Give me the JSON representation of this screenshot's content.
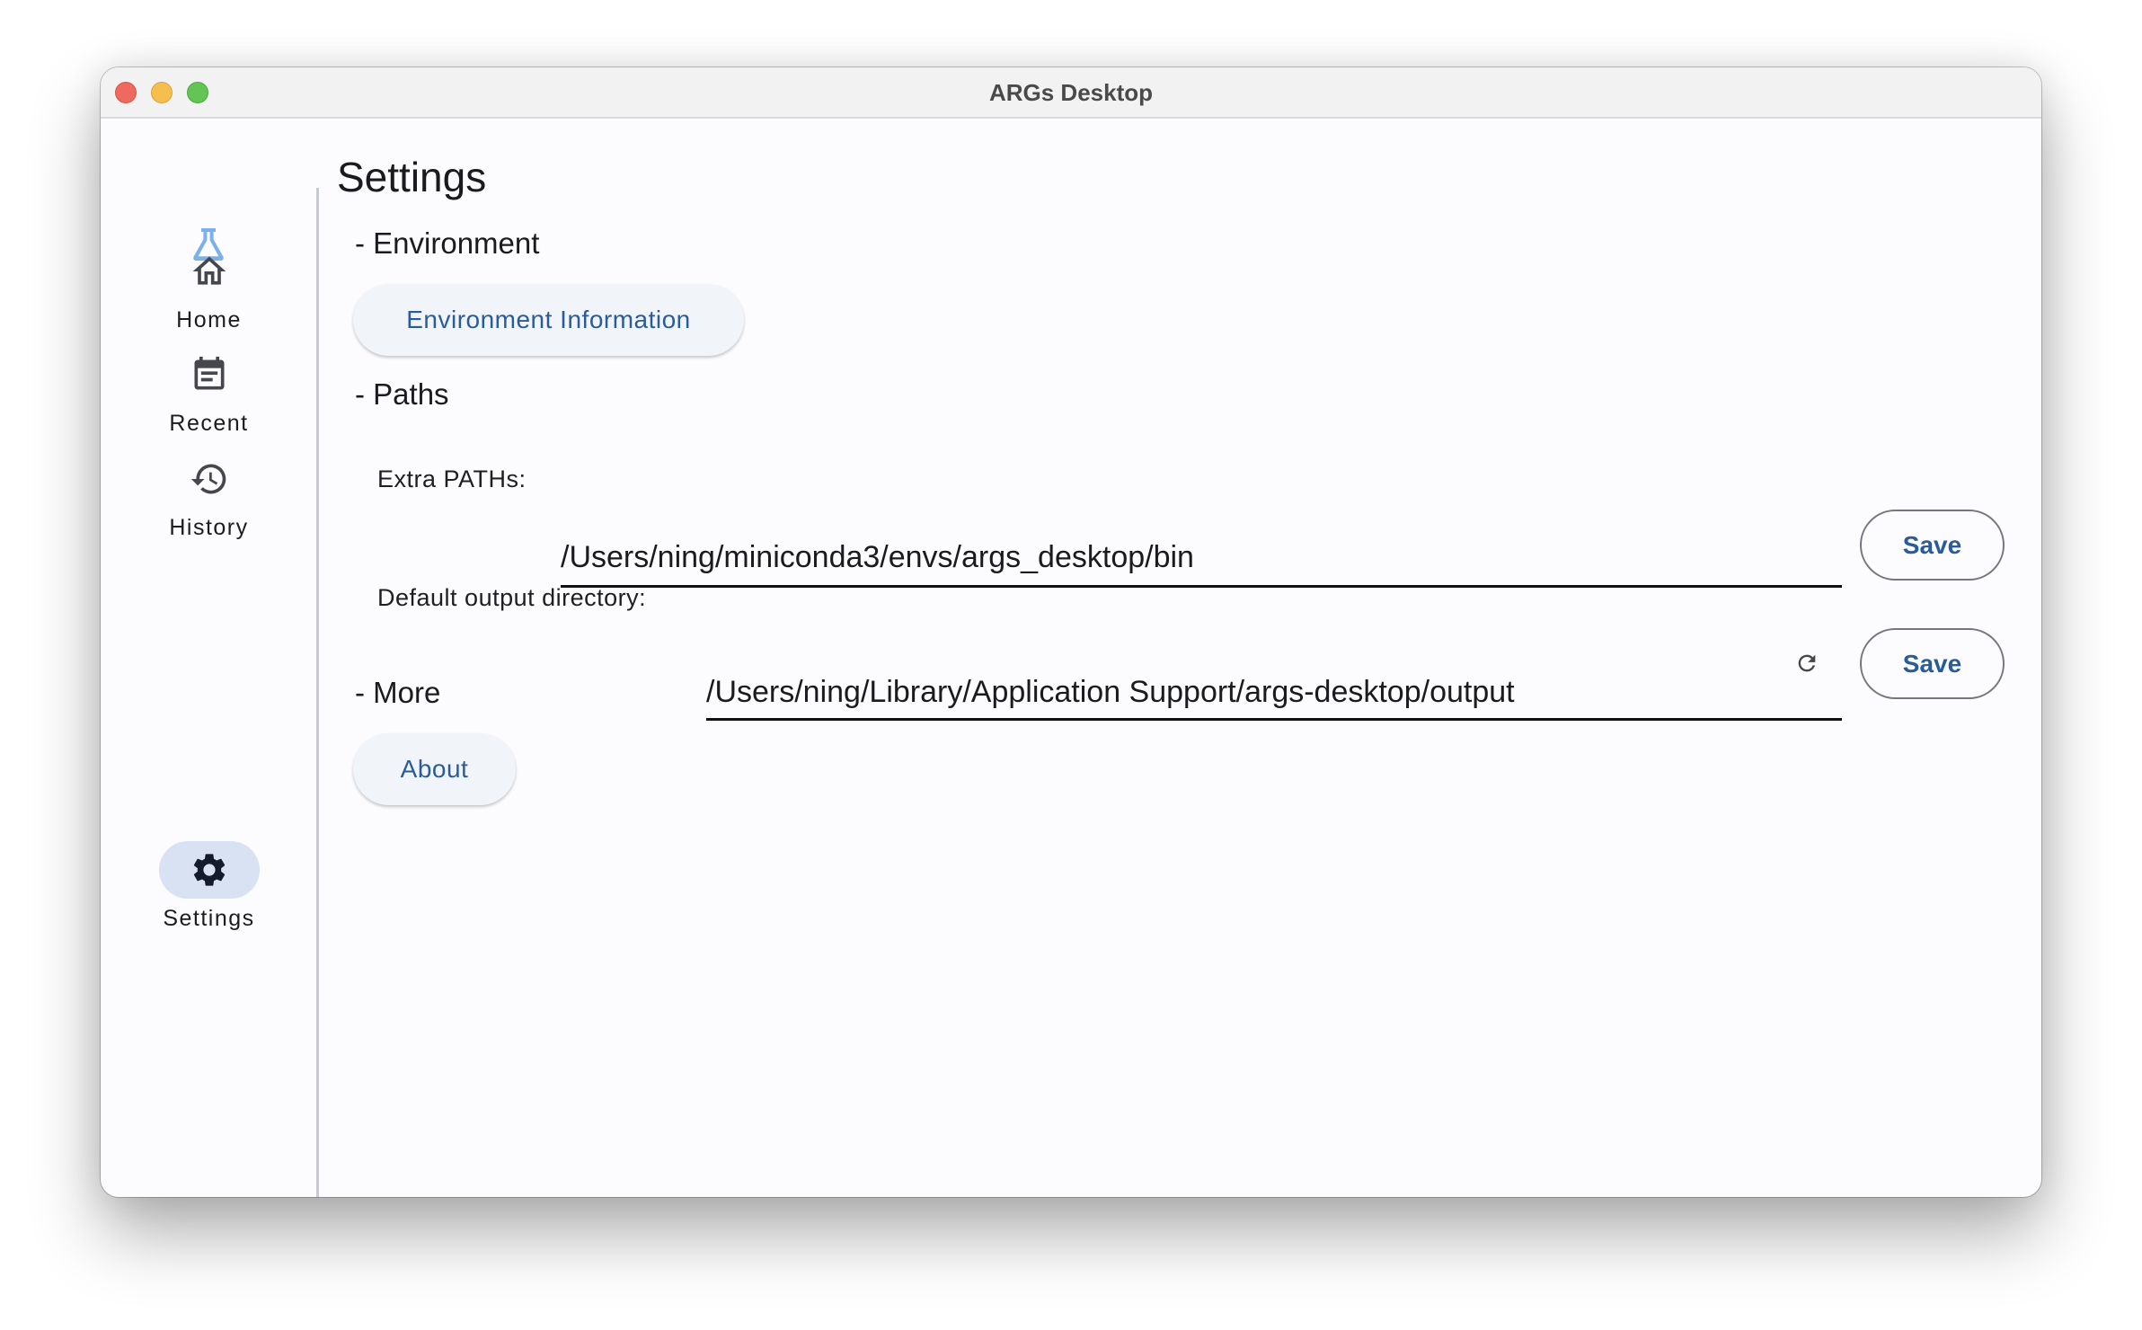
{
  "window": {
    "title": "ARGs Desktop",
    "controls": [
      "close",
      "minimize",
      "maximize"
    ]
  },
  "sidebar": {
    "logo_icon": "flask-icon",
    "logo_color": "#7ab1ec",
    "items": [
      {
        "label": "Home",
        "icon": "home-icon",
        "active": false
      },
      {
        "label": "Recent",
        "icon": "calendar-icon",
        "active": false
      },
      {
        "label": "History",
        "icon": "history-icon",
        "active": false
      },
      {
        "label": "Settings",
        "icon": "gear-icon",
        "active": true
      }
    ],
    "active_color": "#d9e2f3"
  },
  "main": {
    "title": "Settings",
    "sections": {
      "environment": {
        "header": "- Environment",
        "button_label": "Environment Information"
      },
      "paths": {
        "header": "- Paths",
        "extra_paths": {
          "label": "Extra PATHs:",
          "value": "/Users/ning/miniconda3/envs/args_desktop/bin",
          "save_label": "Save"
        },
        "output_dir": {
          "label": "Default output directory:",
          "value": "/Users/ning/Library/Application Support/args-desktop/output",
          "reset_icon": "refresh-icon",
          "save_label": "Save"
        }
      },
      "more": {
        "header": "- More",
        "button_label": "About"
      }
    }
  },
  "colors": {
    "accent_text": "#2a5c99",
    "tonal_button_bg": "#f1f4f9"
  }
}
